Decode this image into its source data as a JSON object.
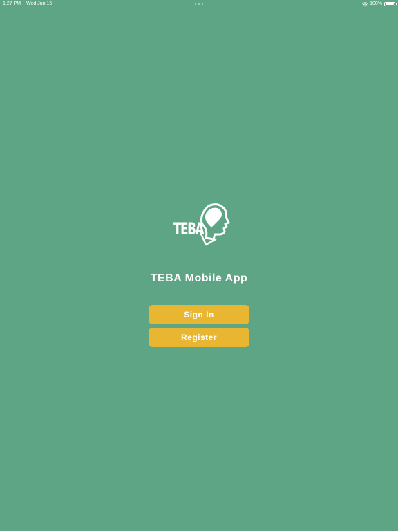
{
  "status_bar": {
    "time": "1:27 PM",
    "date": "Wed Jun 15",
    "battery": "100%",
    "icons": [
      "wifi-icon",
      "battery-icon"
    ]
  },
  "logo": {
    "text": "TEBA",
    "icon": "teba-head-icon"
  },
  "title": "TEBA Mobile App",
  "buttons": {
    "sign_in": "Sign In",
    "register": "Register"
  },
  "colors": {
    "background": "#5ea585",
    "button": "#e8b630",
    "text": "#ffffff"
  }
}
